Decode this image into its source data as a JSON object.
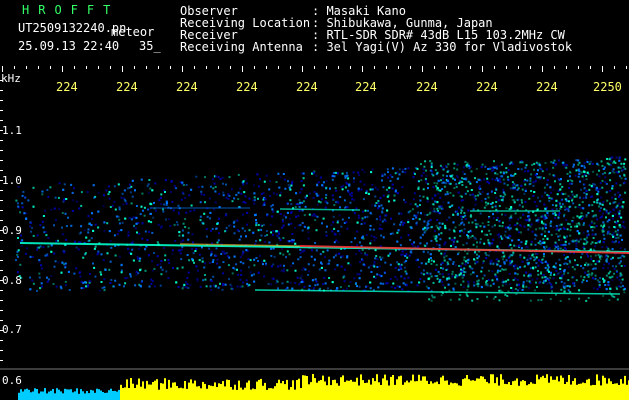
{
  "app": {
    "name": "HROFFT",
    "file": "UT2509132240.pn",
    "mode": "meteor",
    "date_time": "25.09.13 22:40",
    "count": "35_"
  },
  "info": [
    {
      "label": "Observer",
      "value": ": Masaki Kano"
    },
    {
      "label": "Receiving Location",
      "value": ": Shibukawa, Gunma, Japan"
    },
    {
      "label": "Receiver",
      "value": ": RTL-SDR SDR# 43dB L15 103.2MHz CW"
    },
    {
      "label": "Receiving Antenna",
      "value": ": 3el Yagi(V) Az 330 for Vladivostok"
    }
  ],
  "x_axis": {
    "ticks": [
      "224",
      "224",
      "224",
      "224",
      "224",
      "224",
      "224",
      "224",
      "224",
      "2250"
    ]
  },
  "y_axis": {
    "unit": "kHz",
    "ticks": [
      "1.1",
      "1.0",
      "0.9",
      "0.8",
      "0.7",
      "0.6"
    ]
  },
  "colors": {
    "background": "#000000",
    "header_text": "#ffffff",
    "title_text": "#33ff66",
    "file_text": "#ffffff",
    "tick_text": "#ffff66",
    "noise_low": "#0000aa",
    "noise_mid": "#0077ff",
    "noise_high": "#00ffcc",
    "carrier": "#ff3333",
    "level_bar_left": "#00ccff",
    "level_bar_right": "#ffff00"
  }
}
